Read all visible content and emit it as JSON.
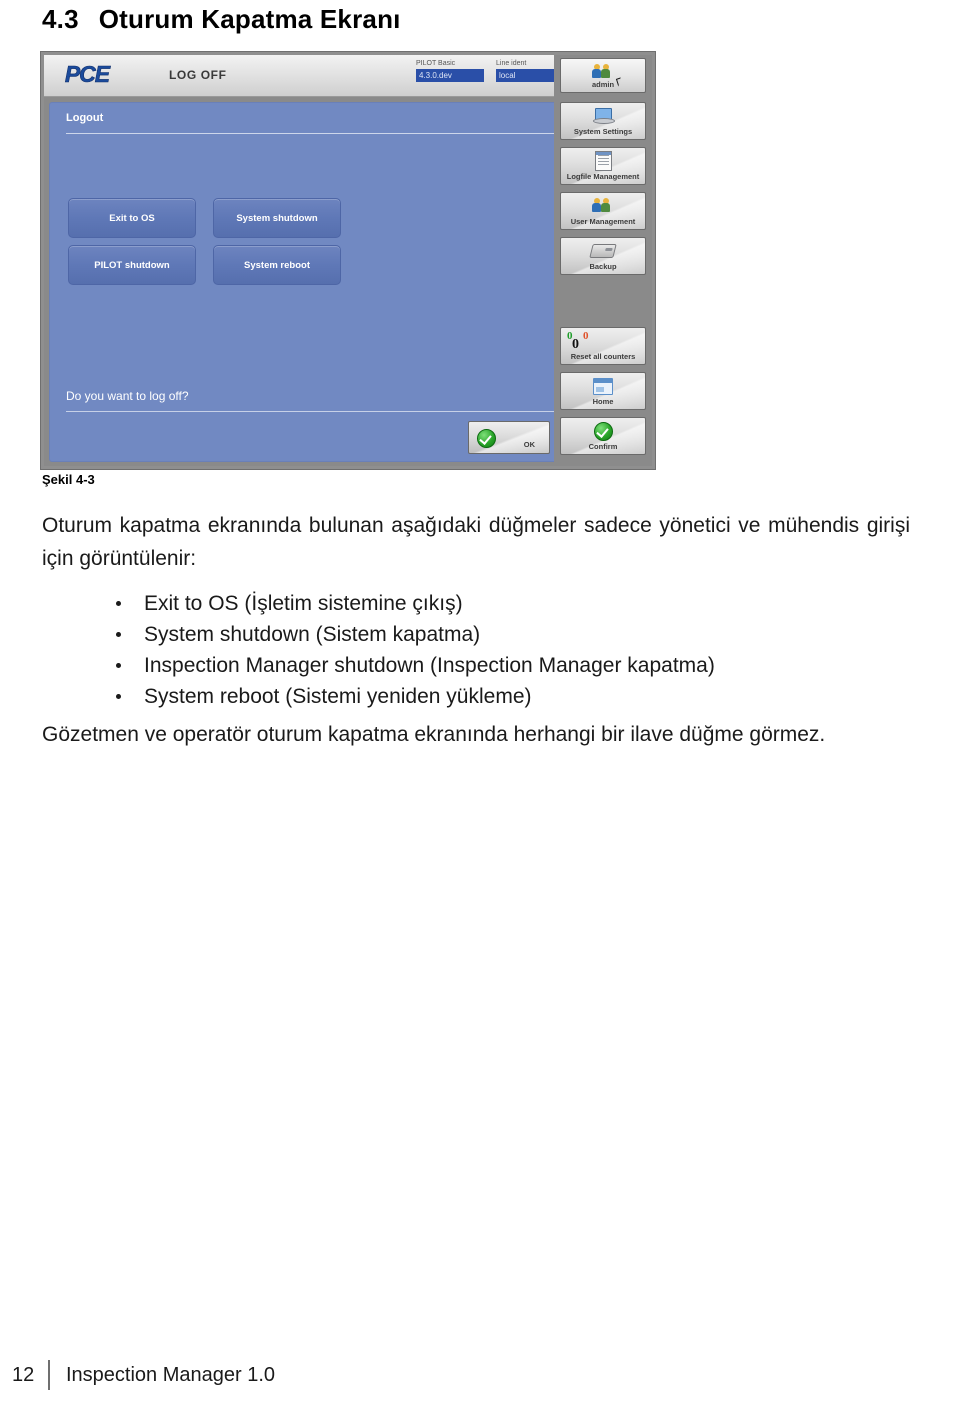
{
  "heading": {
    "number": "4.3",
    "text": "Oturum Kapatma Ekranı"
  },
  "figure": {
    "caption": "Şekil 4-3",
    "app": {
      "logo": "PCE",
      "title": "LOG OFF",
      "ident": {
        "pilot_label": "PILOT Basic",
        "pilot_value": "4.3.0.dev",
        "line_label": "Line ident",
        "line_value": "local"
      },
      "panel": {
        "header": "Logout",
        "question": "Do you want to log off?",
        "ok_label": "OK",
        "buttons": [
          "Exit to OS",
          "System shutdown",
          "PILOT shutdown",
          "System reboot"
        ]
      },
      "rail": {
        "user_label": "admin",
        "items": [
          "System Settings",
          "Logfile Management",
          "User Management",
          "Backup"
        ],
        "counter": {
          "label": "Reset all counters",
          "green": "0",
          "red": "0",
          "black": "0"
        },
        "home_label": "Home",
        "confirm_label": "Confirm"
      },
      "colors": {
        "panel_blue": "#7189C2",
        "button_blue": "#5F78B7",
        "field_blue": "#2A4FA8",
        "logo_blue": "#1B4B9C",
        "rail_gray": "#8A8A8A",
        "check_green": "#2AA52A",
        "counter_red": "#E0522A"
      }
    }
  },
  "body": {
    "paragraph_1": "Oturum kapatma ekranında bulunan aşağıdaki düğmeler sadece yönetici ve mühendis girişi için görüntülenir:",
    "bullets": [
      "Exit to OS (İşletim sistemine çıkış)",
      "System shutdown (Sistem kapatma)",
      "Inspection Manager shutdown (Inspection Manager kapatma)",
      "System reboot (Sistemi yeniden yükleme)"
    ],
    "paragraph_2": "Gözetmen ve operatör oturum kapatma ekranında herhangi bir ilave düğme görmez."
  },
  "footer": {
    "page_number": "12",
    "document_title": "Inspection Manager 1.0"
  }
}
